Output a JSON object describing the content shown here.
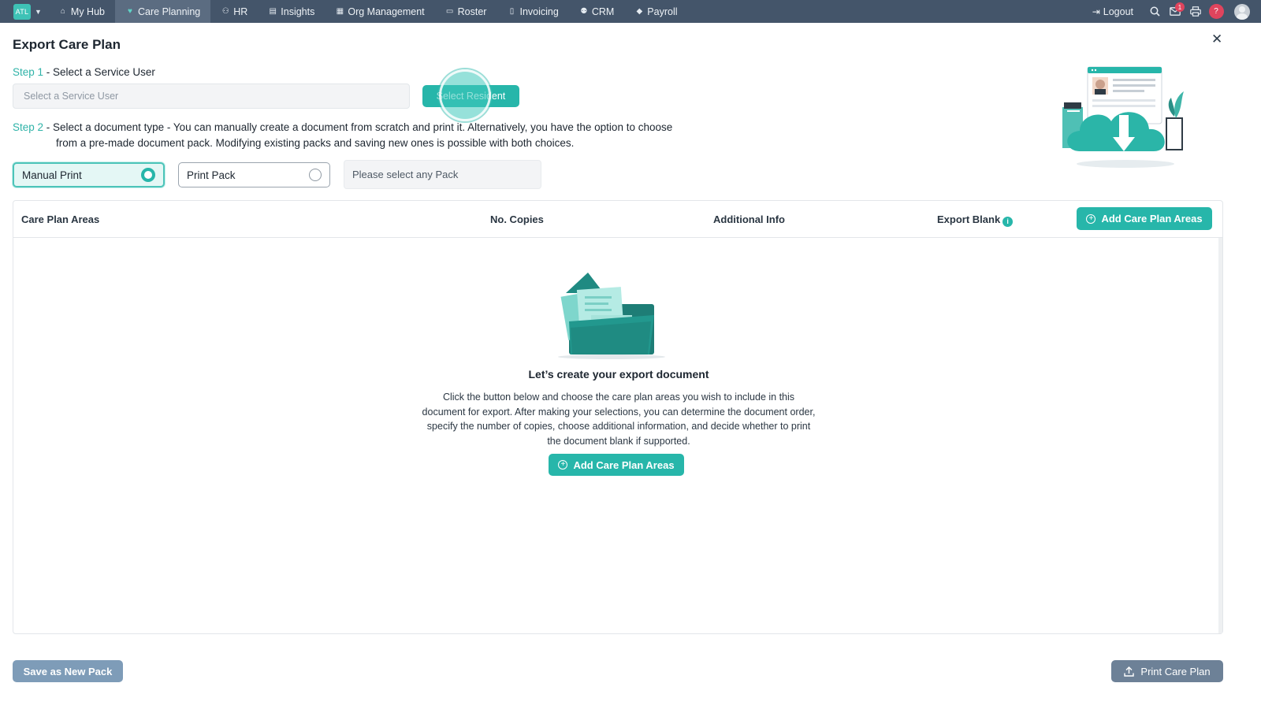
{
  "nav": {
    "brand": "ATL",
    "items": [
      {
        "label": "My Hub",
        "icon": "home-icon",
        "glyph": "⌂"
      },
      {
        "label": "Care Planning",
        "icon": "heart-icon",
        "glyph": "♥"
      },
      {
        "label": "HR",
        "icon": "people-icon",
        "glyph": "⚇"
      },
      {
        "label": "Insights",
        "icon": "chart-icon",
        "glyph": "▤"
      },
      {
        "label": "Org Management",
        "icon": "building-icon",
        "glyph": "▦"
      },
      {
        "label": "Roster",
        "icon": "calendar-icon",
        "glyph": "▭"
      },
      {
        "label": "Invoicing",
        "icon": "file-icon",
        "glyph": "▯"
      },
      {
        "label": "CRM",
        "icon": "users-icon",
        "glyph": "⚉"
      },
      {
        "label": "Payroll",
        "icon": "tag-icon",
        "glyph": "◆"
      }
    ],
    "active": "Care Planning",
    "logout_label": "Logout",
    "notification_count": "1",
    "help_label": "?"
  },
  "dialog": {
    "title": "Export Care Plan",
    "step1_label": "Step 1",
    "step1_text": " - Select a Service User",
    "service_user_placeholder": "Select a Service User",
    "select_resident_label": "Select Resident",
    "step2_label": "Step 2",
    "step2_type": " - Select a document type - ",
    "step2_line1": "You can manually create a document from scratch and print it. Alternatively, you have the option to choose",
    "step2_line2": "from a pre-made document pack. Modifying existing packs and saving new ones is possible with both choices.",
    "options": [
      {
        "label": "Manual Print",
        "selected": true
      },
      {
        "label": "Print Pack",
        "selected": false
      }
    ],
    "pack_placeholder": "Please select any Pack"
  },
  "table": {
    "columns": [
      "Care Plan Areas",
      "No. Copies",
      "Additional Info",
      "Export Blank"
    ],
    "add_label": "Add Care Plan Areas",
    "empty_title": "Let’s create your export document",
    "empty_desc": "Click the button below and choose the care plan areas you wish to include in this document for export. After making your selections, you can determine the document order, specify the number of copies, choose additional information, and decide whether to print the document blank if supported."
  },
  "footer": {
    "save_pack_label": "Save as New Pack",
    "print_label": "Print Care Plan"
  },
  "colors": {
    "accent": "#27b6aa",
    "topbar": "#44556a",
    "danger": "#e0445d"
  }
}
